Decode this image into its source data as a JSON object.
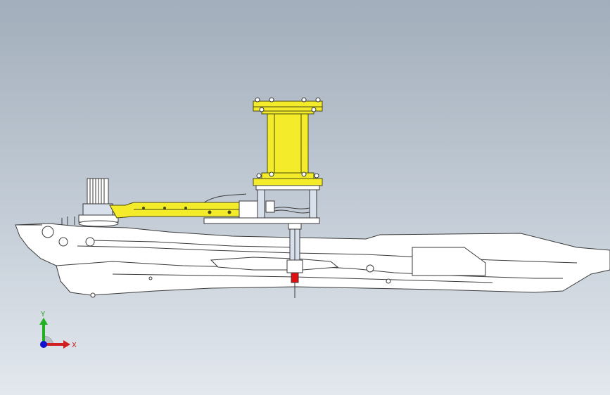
{
  "viewport": {
    "background_top": "#a2aebb",
    "background_bottom": "#e3e8ee"
  },
  "model": {
    "parts": [
      "base-frame",
      "turntable",
      "rotary-arm",
      "cylinder-tower",
      "column-posts",
      "vertical-post",
      "red-marker"
    ],
    "colors": {
      "frame_fill": "#ffffff",
      "frame_edge": "#3a3a3a",
      "highlight_yellow": "#f4ec2a",
      "yellow_edge": "#4a4a10",
      "post_fill": "#d8e0ec",
      "marker_red": "#e01010"
    }
  },
  "triad": {
    "x_label": "X",
    "y_label": "Y",
    "x_color": "#d02020",
    "y_color": "#20b020",
    "z_color": "#1010d0",
    "icons": [
      "x-axis-arrow-icon",
      "y-axis-arrow-icon",
      "z-axis-dot-icon"
    ]
  }
}
